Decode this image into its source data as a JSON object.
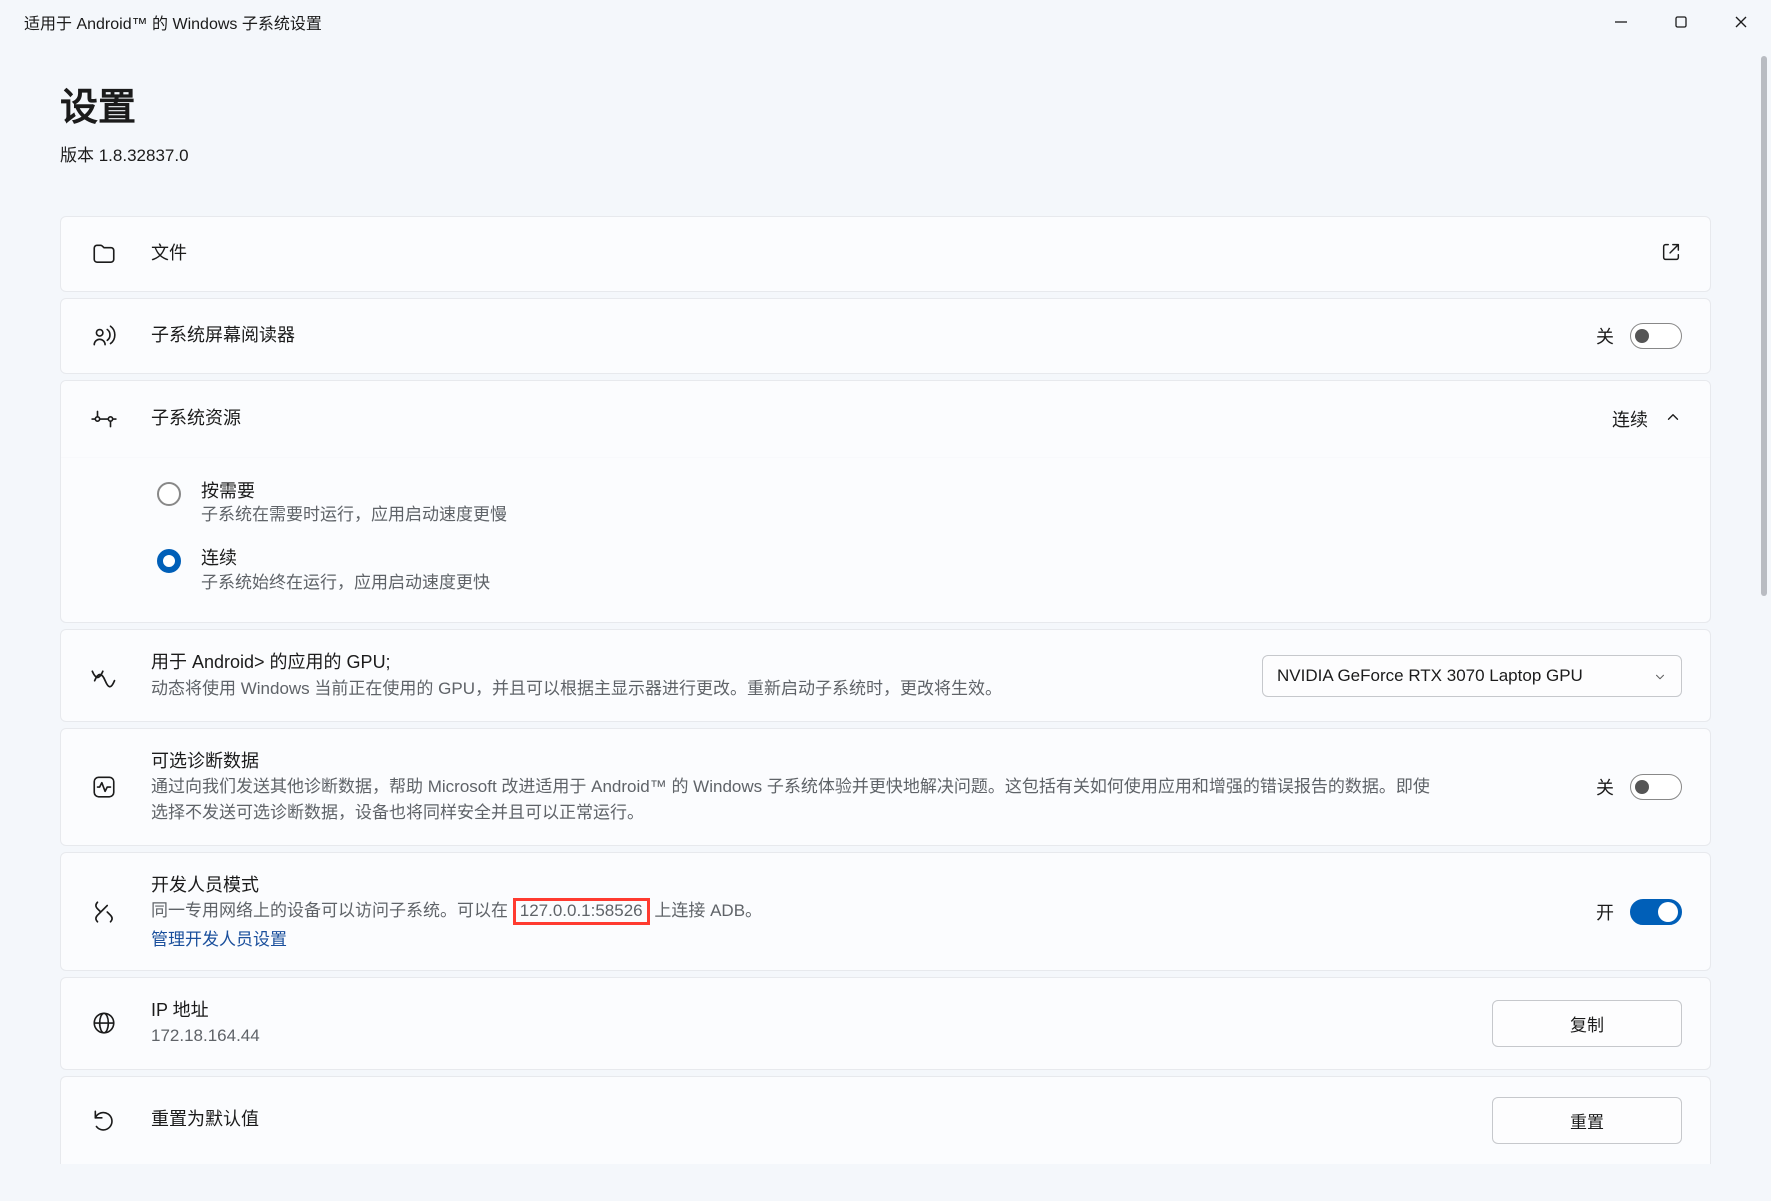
{
  "window": {
    "title": "适用于 Android™ 的 Windows 子系统设置"
  },
  "header": {
    "title": "设置",
    "version": "版本 1.8.32837.0"
  },
  "cards": {
    "files": {
      "title": "文件"
    },
    "reader": {
      "title": "子系统屏幕阅读器",
      "state": "关"
    },
    "resources": {
      "title": "子系统资源",
      "state": "连续",
      "options": [
        {
          "title": "按需要",
          "desc": "子系统在需要时运行，应用启动速度更慢"
        },
        {
          "title": "连续",
          "desc": "子系统始终在运行，应用启动速度更快"
        }
      ]
    },
    "gpu": {
      "title": "用于 Android> 的应用的 GPU;",
      "desc": "动态将使用 Windows 当前正在使用的 GPU，并且可以根据主显示器进行更改。重新启动子系统时，更改将生效。",
      "selected": "NVIDIA GeForce RTX 3070 Laptop GPU"
    },
    "diag": {
      "title": "可选诊断数据",
      "desc": "通过向我们发送其他诊断数据，帮助 Microsoft 改进适用于 Android™ 的 Windows 子系统体验并更快地解决问题。这包括有关如何使用应用和增强的错误报告的数据。即使选择不发送可选诊断数据，设备也将同样安全并且可以正常运行。",
      "state": "关"
    },
    "dev": {
      "title": "开发人员模式",
      "desc_before": "同一专用网络上的设备可以访问子系统。可以在 ",
      "address": "127.0.0.1:58526",
      "desc_after": " 上连接 ADB。",
      "link": "管理开发人员设置",
      "state": "开"
    },
    "ip": {
      "title": "IP 地址",
      "value": "172.18.164.44",
      "button": "复制"
    },
    "reset": {
      "title": "重置为默认值",
      "button": "重置"
    }
  }
}
